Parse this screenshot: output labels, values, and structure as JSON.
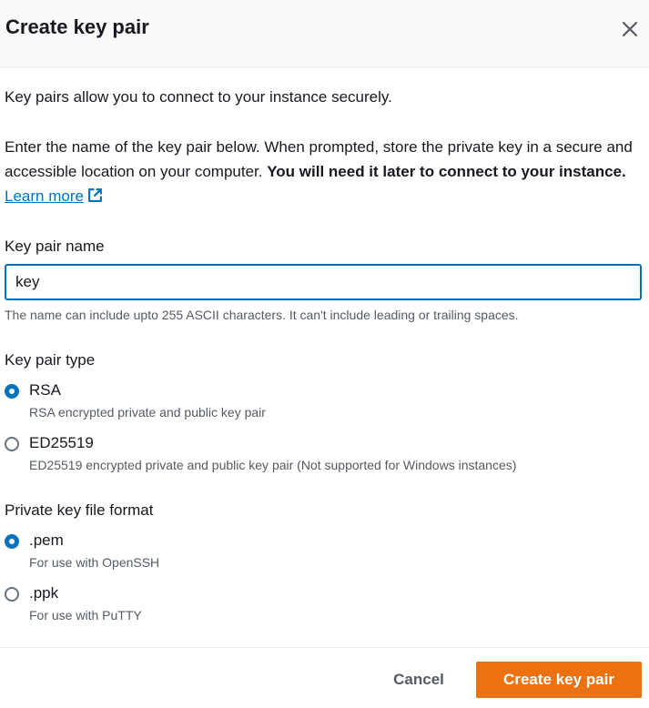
{
  "dialog": {
    "title": "Create key pair",
    "intro": "Key pairs allow you to connect to your instance securely.",
    "instructions": "Enter the name of the key pair below. When prompted, store the private key in a secure and accessible location on your computer. ",
    "instructions_bold": "You will need it later to connect to your instance.",
    "learn_more": "Learn more"
  },
  "name_field": {
    "label": "Key pair name",
    "value": "key",
    "hint": "The name can include upto 255 ASCII characters. It can't include leading or trailing spaces."
  },
  "key_type": {
    "label": "Key pair type",
    "options": [
      {
        "label": "RSA",
        "description": "RSA encrypted private and public key pair",
        "selected": true
      },
      {
        "label": "ED25519",
        "description": "ED25519 encrypted private and public key pair (Not supported for Windows instances)",
        "selected": false
      }
    ]
  },
  "file_format": {
    "label": "Private key file format",
    "options": [
      {
        "label": ".pem",
        "description": "For use with OpenSSH",
        "selected": true
      },
      {
        "label": ".ppk",
        "description": "For use with PuTTY",
        "selected": false
      }
    ]
  },
  "footer": {
    "cancel_label": "Cancel",
    "create_label": "Create key pair"
  },
  "colors": {
    "accent": "#0073bb",
    "primary_button": "#ec7211"
  }
}
